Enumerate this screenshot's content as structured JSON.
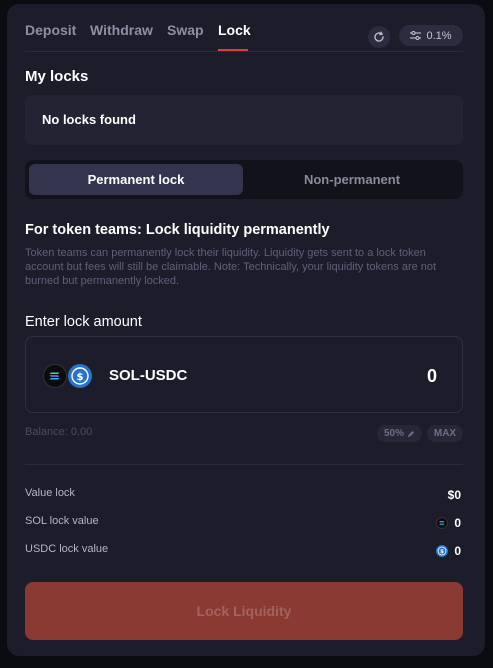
{
  "tabs": [
    {
      "label": "Deposit"
    },
    {
      "label": "Withdraw"
    },
    {
      "label": "Swap"
    },
    {
      "label": "Lock"
    }
  ],
  "active_tab": "Lock",
  "slippage": "0.1%",
  "my_locks": {
    "title": "My locks",
    "empty_text": "No locks found"
  },
  "lock_type": {
    "options": [
      "Permanent lock",
      "Non-permanent"
    ],
    "selected": "Permanent lock"
  },
  "info": {
    "title": "For token teams: Lock liquidity permanently",
    "description": "Token teams can permanently lock their liquidity. Liquidity gets sent to a lock token account but fees will still be claimable. Note: Technically, your liquidity tokens are not burned but permanently locked."
  },
  "amount": {
    "label": "Enter lock amount",
    "pair": "SOL-USDC",
    "value": "0",
    "balance": "Balance: 0.00",
    "half_label": "50%",
    "max_label": "MAX"
  },
  "summary": [
    {
      "label": "Value lock",
      "value": "$0",
      "icon": ""
    },
    {
      "label": "SOL lock value",
      "value": "0",
      "icon": "sol-icon"
    },
    {
      "label": "USDC lock value",
      "value": "0",
      "icon": "usdc-icon"
    }
  ],
  "submit_label": "Lock Liquidity",
  "colors": {
    "accent": "#d9443a",
    "button": "#8a3a33",
    "panel": "#1c1c2b"
  }
}
